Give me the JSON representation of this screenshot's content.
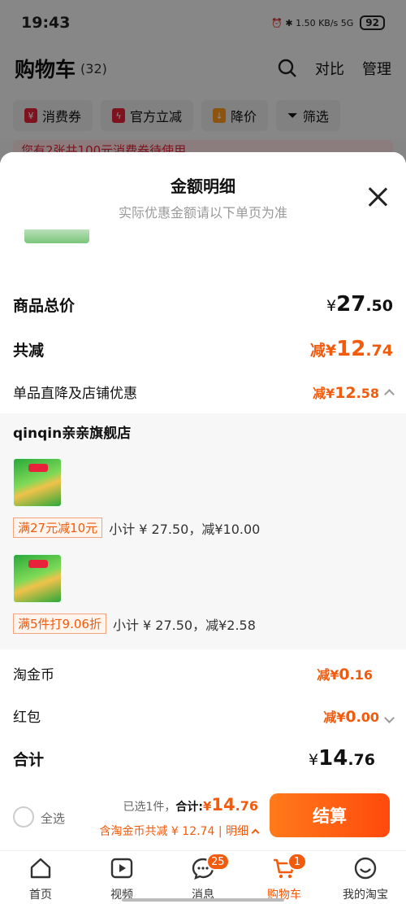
{
  "status": {
    "time": "19:43",
    "signal_text": "⏰ ✱ 1.50 KB/s 5G",
    "battery": "92"
  },
  "header": {
    "title": "购物车",
    "count": "(32)",
    "compare": "对比",
    "manage": "管理"
  },
  "chips": [
    {
      "icon": "coupon-icon",
      "label": "消费券"
    },
    {
      "icon": "flash-icon",
      "label": "官方立减"
    },
    {
      "icon": "price-drop-icon",
      "label": "降价"
    },
    {
      "icon": "filter-icon",
      "label": "筛选"
    }
  ],
  "promo_bg": "您有2张共100元消费券待使用",
  "sheet": {
    "title": "金额明细",
    "subtitle": "实际优惠金额请以下单页为准",
    "total_label": "商品总价",
    "total": {
      "cur": "¥",
      "int": "27",
      "dec": ".50"
    },
    "discount_label": "共减",
    "discount": {
      "pre": "减¥",
      "int": "12",
      "dec": ".74"
    },
    "store_discount_label": "单品直降及店铺优惠",
    "store_discount": {
      "pre": "减¥",
      "int": "12",
      "dec": ".58"
    },
    "store_name": "qinqin亲亲旗舰店",
    "items": [
      {
        "tag": "满27元减10元",
        "text": "小计 ¥ 27.50，减¥10.00"
      },
      {
        "tag": "满5件打9.06折",
        "text": "小计 ¥ 27.50，减¥2.58"
      }
    ],
    "coins_label": "淘金币",
    "coins": {
      "pre": "减¥",
      "int": "0",
      "dec": ".16"
    },
    "redpacket_label": "红包",
    "redpacket": {
      "pre": "减¥",
      "int": "0",
      "dec": ".00"
    },
    "sum_label": "合计",
    "sum": {
      "cur": "¥",
      "int": "14",
      "dec": ".76"
    }
  },
  "actionbar": {
    "select_all": "全选",
    "selected_text": "已选1件，",
    "total_label": "合计:",
    "total": {
      "cur": "¥",
      "int": "14",
      "dec": ".76"
    },
    "savings": "含淘金币共减 ¥ 12.74 | 明细",
    "checkout": "结算"
  },
  "tabs": [
    {
      "label": "首页",
      "icon": "home-icon"
    },
    {
      "label": "视频",
      "icon": "video-icon"
    },
    {
      "label": "消息",
      "icon": "message-icon",
      "badge": "25"
    },
    {
      "label": "购物车",
      "icon": "cart-icon",
      "badge": "1",
      "active": true
    },
    {
      "label": "我的淘宝",
      "icon": "profile-icon"
    }
  ],
  "colors": {
    "accent": "#f25a0c",
    "checkout_start": "#ff7a1a",
    "checkout_end": "#ff4a0d"
  }
}
